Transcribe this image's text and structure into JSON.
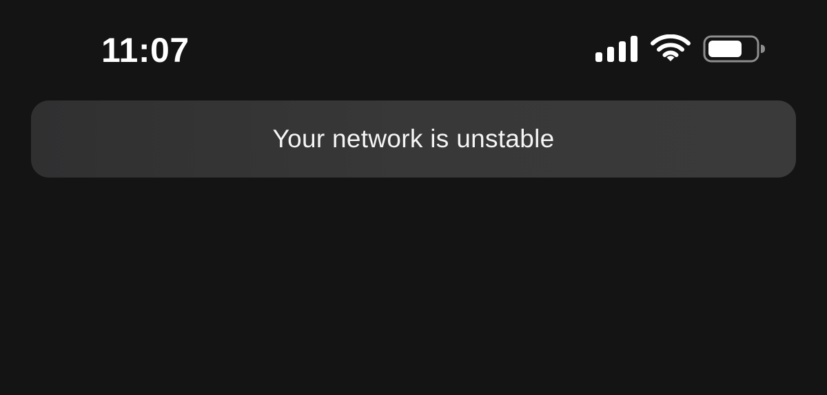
{
  "status_bar": {
    "time": "11:07",
    "icons": {
      "signal": "cellular-signal-icon",
      "wifi": "wifi-icon",
      "battery": "battery-icon"
    }
  },
  "toast": {
    "message": "Your network is unstable"
  },
  "colors": {
    "background": "#151415",
    "toast_background": "#363636",
    "text": "#ffffff"
  }
}
